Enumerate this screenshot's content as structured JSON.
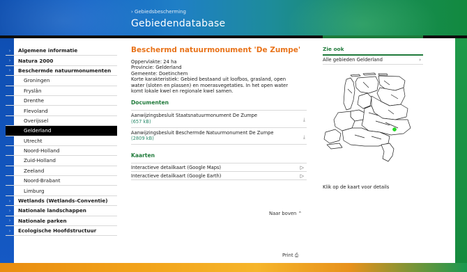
{
  "header": {
    "breadcrumb": "› Gebiedsbescherming",
    "title": "Gebiedendatabase"
  },
  "sidebar": {
    "items": [
      {
        "label": "Algemene informatie",
        "level": "top"
      },
      {
        "label": "Natura 2000",
        "level": "top"
      },
      {
        "label": "Beschermde natuurmonumenten",
        "level": "top"
      },
      {
        "label": "Groningen",
        "level": "sub"
      },
      {
        "label": "Fryslân",
        "level": "sub"
      },
      {
        "label": "Drenthe",
        "level": "sub"
      },
      {
        "label": "Flevoland",
        "level": "sub"
      },
      {
        "label": "Overijssel",
        "level": "sub"
      },
      {
        "label": "Gelderland",
        "level": "sub",
        "active": true
      },
      {
        "label": "Utrecht",
        "level": "sub"
      },
      {
        "label": "Noord-Holland",
        "level": "sub"
      },
      {
        "label": "Zuid-Holland",
        "level": "sub"
      },
      {
        "label": "Zeeland",
        "level": "sub"
      },
      {
        "label": "Noord-Brabant",
        "level": "sub"
      },
      {
        "label": "Limburg",
        "level": "sub"
      },
      {
        "label": "Wetlands (Wetlands-Conventie)",
        "level": "top"
      },
      {
        "label": "Nationale landschappen",
        "level": "top"
      },
      {
        "label": "Nationale parken",
        "level": "top"
      },
      {
        "label": "Ecologische Hoofdstructuur",
        "level": "top"
      }
    ],
    "arrow_glyph": "›"
  },
  "main": {
    "title": "Beschermd natuurmonument 'De Zumpe'",
    "info": [
      "Oppervlakte: 24 ha",
      "Provincie: Gelderland",
      "Gemeente: Doetinchem",
      "Korte karakteristiek: Gebied bestaand uit loofbos, grasland, open",
      "water (sloten en plassen) en moerasvegetaties. In het open water",
      "komt lokale kwel en regionale kwel samen."
    ],
    "documents_heading": "Documenten",
    "documents": [
      {
        "title": "Aanwijzingsbesluit Staatsnatuurmonument De Zumpe",
        "size": "(657 kB)"
      },
      {
        "title": "Aanwijzingsbesluit Beschermde Natuurmonument De Zumpe",
        "size": "(2809 kB)"
      }
    ],
    "maps_heading": "Kaarten",
    "maps": [
      {
        "title": "Interactieve detailkaart (Google Maps)"
      },
      {
        "title": "Interactieve detailkaart (Google Earth)"
      }
    ],
    "back_to_top": "Naar boven ⌃",
    "print": "Print ⎙"
  },
  "right": {
    "see_also_heading": "Zie ook",
    "see_also_link": "Alle gebieden Gelderland",
    "map_caption": "Klik op de kaart voor details"
  },
  "icons": {
    "download": "⤓",
    "open": "▷",
    "chevron": "›"
  },
  "colors": {
    "accent_orange": "#e8731a",
    "heading_green": "#1f7a3a",
    "size_teal": "#2a8a6a",
    "marker_green": "#22dd22",
    "active_bg": "#000000"
  }
}
